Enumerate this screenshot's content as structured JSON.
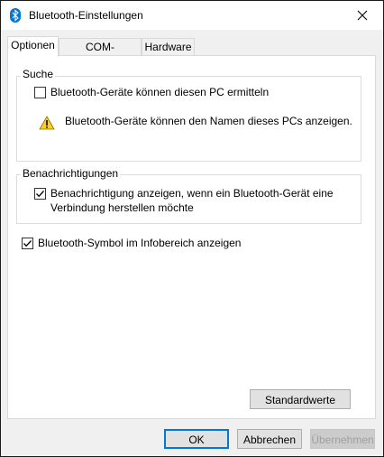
{
  "window": {
    "title": "Bluetooth-Einstellungen",
    "close_glyph": "✕",
    "accent": "#0078d7"
  },
  "tabs": [
    {
      "label": "Optionen",
      "active": true
    },
    {
      "label": "COM-Anschlüsse",
      "active": false
    },
    {
      "label": "Hardware",
      "active": false
    }
  ],
  "search_group": {
    "label": "Suche",
    "discover_checkbox": {
      "label": "Bluetooth-Geräte können diesen PC ermitteln",
      "checked": false
    },
    "warning_text": "Bluetooth-Geräte können den Namen dieses PCs anzeigen."
  },
  "notifications_group": {
    "label": "Benachrichtigungen",
    "notify_checkbox": {
      "label_line1": "Benachrichtigung anzeigen, wenn ein Bluetooth-Gerät eine",
      "label_line2": "Verbindung herstellen möchte",
      "checked": true
    }
  },
  "tray_checkbox": {
    "label": "Bluetooth-Symbol im Infobereich anzeigen",
    "checked": true
  },
  "buttons": {
    "defaults": "Standardwerte",
    "ok": "OK",
    "cancel": "Abbrechen",
    "apply": "Übernehmen"
  }
}
